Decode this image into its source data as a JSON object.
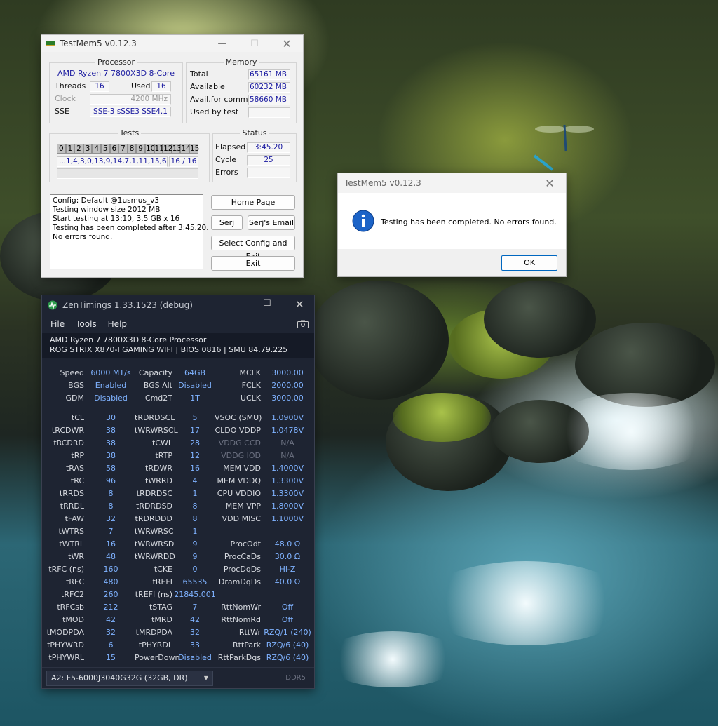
{
  "testmem": {
    "title": "TestMem5 v0.12.3",
    "processor": {
      "caption": "Processor",
      "name": "AMD Ryzen 7 7800X3D 8-Core",
      "threads_label": "Threads",
      "threads": "16",
      "used_label": "Used",
      "used": "16",
      "clock_label": "Clock",
      "clock": "4200 MHz",
      "sse_label": "SSE",
      "sse": "SSE-3 sSSE3 SSE4.1"
    },
    "memory": {
      "caption": "Memory",
      "total_label": "Total",
      "total": "65161 MB",
      "available_label": "Available",
      "available": "60232 MB",
      "commit_label": "Avail.for commit",
      "commit": "58660 MB",
      "usedbytest_label": "Used by test",
      "usedbytest": ""
    },
    "tests": {
      "caption": "Tests",
      "numbers": [
        "0",
        "1",
        "2",
        "3",
        "4",
        "5",
        "6",
        "7",
        "8",
        "9",
        "10",
        "11",
        "12",
        "13",
        "14",
        "15"
      ],
      "sequence": "...1,4,3,0,13,9,14,7,1,11,15,6",
      "progress": "16 / 16"
    },
    "status": {
      "caption": "Status",
      "elapsed_label": "Elapsed",
      "elapsed": "3:45.20",
      "cycle_label": "Cycle",
      "cycle": "25",
      "errors_label": "Errors",
      "errors": ""
    },
    "log": "Config: Default @1usmus_v3\nTesting window size 2012 MB\nStart testing at 13:10, 3.5 GB x 16\nTesting has been completed after 3:45.20.\nNo errors found.",
    "buttons": {
      "home": "Home Page",
      "serj": "Serj",
      "email": "Serj's Email",
      "select": "Select Config and Exit",
      "exit": "Exit"
    }
  },
  "dialog": {
    "title": "TestMem5 v0.12.3",
    "message": "Testing has been completed. No errors found.",
    "ok": "OK"
  },
  "zen": {
    "title": "ZenTimings 1.33.1523 (debug)",
    "menu": [
      "File",
      "Tools",
      "Help"
    ],
    "cpu": "AMD Ryzen 7 7800X3D 8-Core Processor",
    "board": "ROG STRIX X870-I GAMING WIFI | BIOS 0816 | SMU 84.79.225",
    "top": [
      [
        "Speed",
        "6000 MT/s",
        "Capacity",
        "64GB",
        "MCLK",
        "3000.00"
      ],
      [
        "BGS",
        "Enabled",
        "BGS Alt",
        "Disabled",
        "FCLK",
        "2000.00"
      ],
      [
        "GDM",
        "Disabled",
        "Cmd2T",
        "1T",
        "UCLK",
        "3000.00"
      ]
    ],
    "rows": [
      [
        "tCL",
        "30",
        "tRDRDSCL",
        "5",
        "VSOC (SMU)",
        "1.0900V"
      ],
      [
        "tRCDWR",
        "38",
        "tWRWRSCL",
        "17",
        "CLDO VDDP",
        "1.0478V"
      ],
      [
        "tRCDRD",
        "38",
        "tCWL",
        "28",
        "VDDG CCD",
        "N/A"
      ],
      [
        "tRP",
        "38",
        "tRTP",
        "12",
        "VDDG IOD",
        "N/A"
      ],
      [
        "tRAS",
        "58",
        "tRDWR",
        "16",
        "MEM VDD",
        "1.4000V"
      ],
      [
        "tRC",
        "96",
        "tWRRD",
        "4",
        "MEM VDDQ",
        "1.3300V"
      ],
      [
        "tRRDS",
        "8",
        "tRDRDSC",
        "1",
        "CPU VDDIO",
        "1.3300V"
      ],
      [
        "tRRDL",
        "8",
        "tRDRDSD",
        "8",
        "MEM VPP",
        "1.8000V"
      ],
      [
        "tFAW",
        "32",
        "tRDRDDD",
        "8",
        "VDD MISC",
        "1.1000V"
      ],
      [
        "tWTRS",
        "7",
        "tWRWRSC",
        "1",
        "",
        ""
      ],
      [
        "tWTRL",
        "16",
        "tWRWRSD",
        "9",
        "ProcOdt",
        "48.0 Ω"
      ],
      [
        "tWR",
        "48",
        "tWRWRDD",
        "9",
        "ProcCaDs",
        "30.0 Ω"
      ],
      [
        "tRFC (ns)",
        "160",
        "tCKE",
        "0",
        "ProcDqDs",
        "Hi-Z"
      ],
      [
        "tRFC",
        "480",
        "tREFI",
        "65535",
        "DramDqDs",
        "40.0 Ω"
      ],
      [
        "tRFC2",
        "260",
        "tREFI (ns)",
        "21845.001",
        "",
        ""
      ],
      [
        "tRFCsb",
        "212",
        "tSTAG",
        "7",
        "RttNomWr",
        "Off"
      ],
      [
        "tMOD",
        "42",
        "tMRD",
        "42",
        "RttNomRd",
        "Off"
      ],
      [
        "tMODPDA",
        "32",
        "tMRDPDA",
        "32",
        "RttWr",
        "RZQ/1 (240)"
      ],
      [
        "tPHYWRD",
        "6",
        "tPHYRDL",
        "33",
        "RttPark",
        "RZQ/6 (40)"
      ],
      [
        "tPHYWRL",
        "15",
        "PowerDown",
        "Disabled",
        "RttParkDqs",
        "RZQ/6 (40)"
      ]
    ],
    "module": "A2: F5-6000J3040G32G (32GB, DR)",
    "ddr": "DDR5"
  }
}
